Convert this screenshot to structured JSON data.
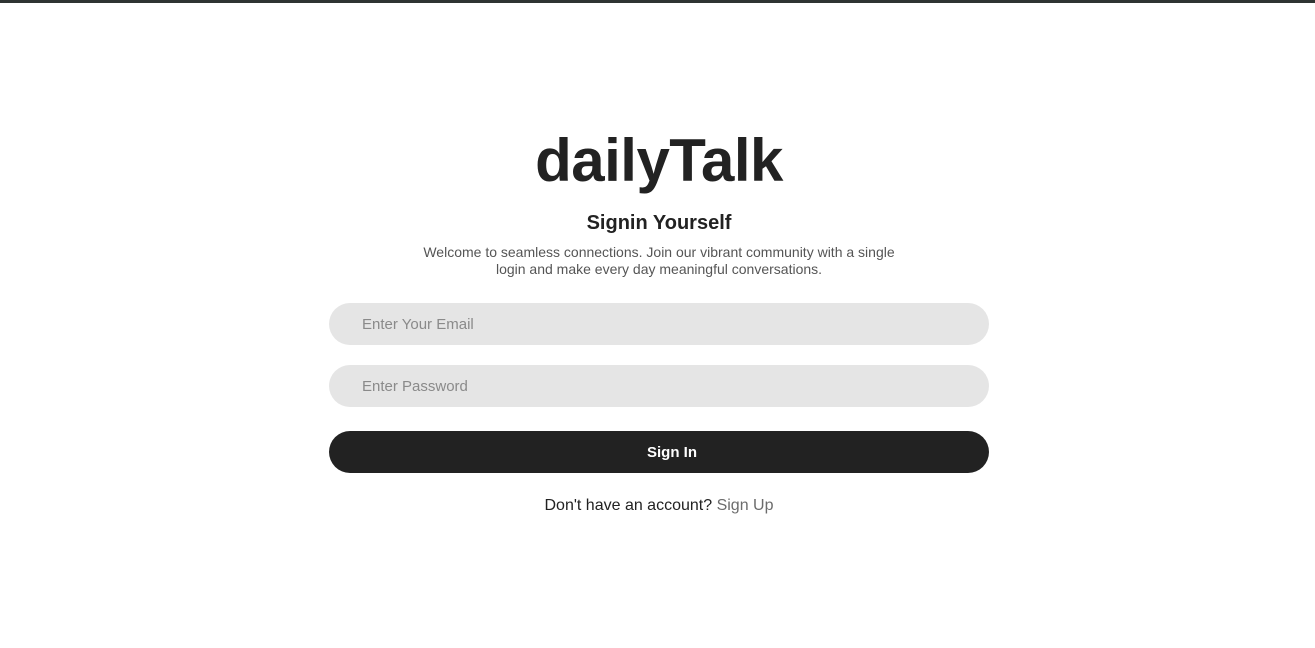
{
  "brand": {
    "title": "dailyTalk"
  },
  "form": {
    "heading": "Signin Yourself",
    "description": "Welcome to seamless connections. Join our vibrant community with a single login and make every day meaningful conversations.",
    "email": {
      "value": "",
      "placeholder": "Enter Your Email"
    },
    "password": {
      "value": "",
      "placeholder": "Enter Password"
    },
    "submit_label": "Sign In",
    "signup_prompt": "Don't have an account?",
    "signup_link": "Sign Up"
  },
  "colors": {
    "primary": "#222222",
    "field_bg": "#e5e5e5",
    "link": "#6c6c6c",
    "top_border": "#2f3432"
  }
}
